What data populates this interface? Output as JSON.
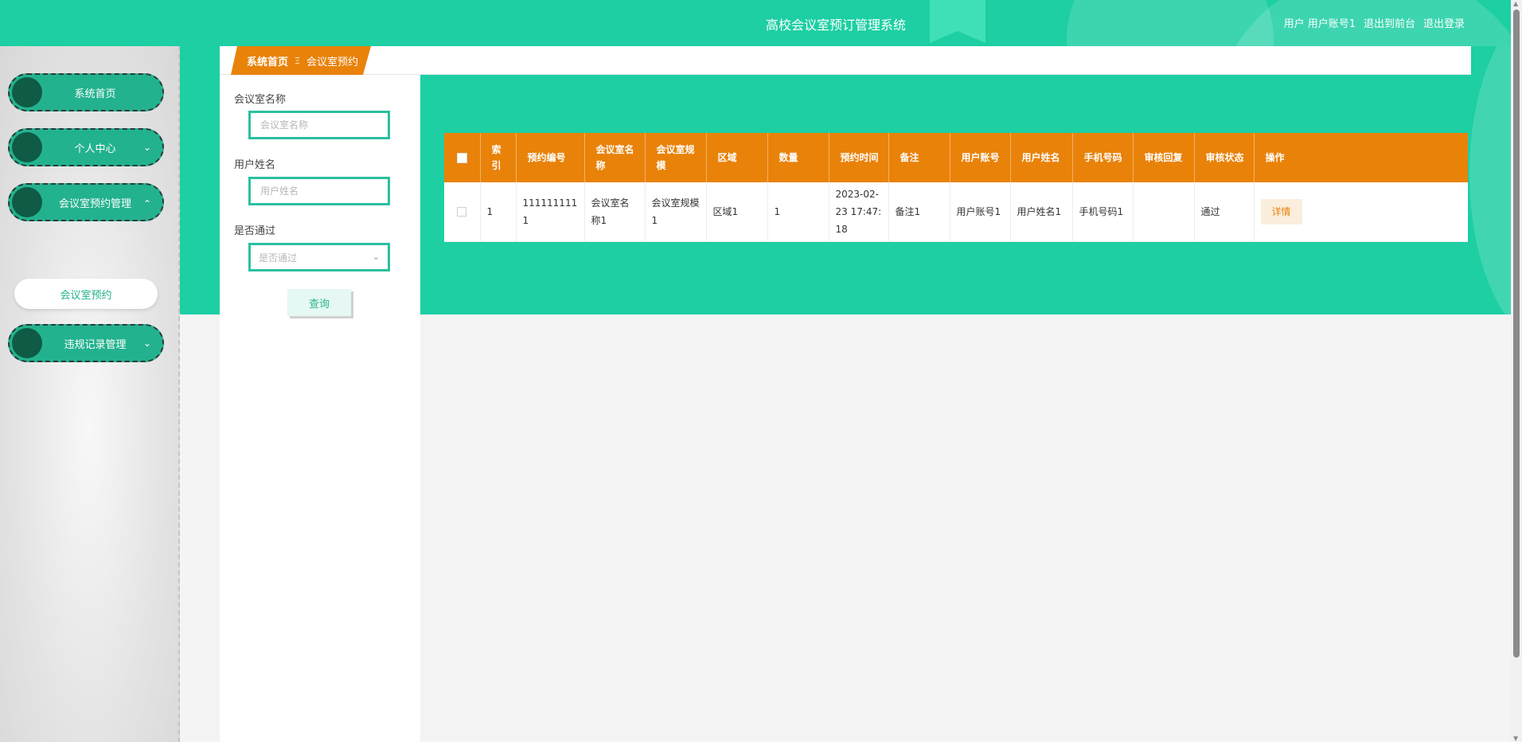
{
  "header": {
    "title": "高校会议室预订管理系统",
    "user_label": "用户",
    "username": "用户账号1",
    "to_front_label": "退出到前台",
    "logout_label": "退出登录"
  },
  "sidebar": {
    "items": [
      {
        "label": "系统首页",
        "expanded": null
      },
      {
        "label": "个人中心",
        "expanded": false
      },
      {
        "label": "会议室预约管理",
        "expanded": true
      },
      {
        "label": "违规记录管理",
        "expanded": false
      }
    ],
    "sub_item": {
      "label": "会议室预约"
    }
  },
  "breadcrumb": {
    "home": "系统首页",
    "separator": "Ξ",
    "current": "会议室预约"
  },
  "search": {
    "room_name_label": "会议室名称",
    "room_name_placeholder": "会议室名称",
    "user_name_label": "用户姓名",
    "user_name_placeholder": "用户姓名",
    "approved_label": "是否通过",
    "approved_placeholder": "是否通过",
    "query_button": "查询"
  },
  "table": {
    "headers": [
      "索引",
      "预约编号",
      "会议室名称",
      "会议室规模",
      "区域",
      "数量",
      "预约时间",
      "备注",
      "用户账号",
      "用户姓名",
      "手机号码",
      "审核回复",
      "审核状态",
      "操作"
    ],
    "rows": [
      {
        "index": "1",
        "booking_no": "1111111111",
        "room_name": "会议室名称1",
        "room_scale": "会议室规模1",
        "area": "区域1",
        "quantity": "1",
        "booking_time": "2023-02-23 17:47:18",
        "remark": "备注1",
        "user_account": "用户账号1",
        "user_name": "用户姓名1",
        "phone": "手机号码1",
        "review_reply": "",
        "review_status": "通过",
        "action_label": "详情"
      }
    ]
  },
  "colors": {
    "primary": "#1dcfa3",
    "accent": "#e98209",
    "menu": "#23b28e"
  }
}
